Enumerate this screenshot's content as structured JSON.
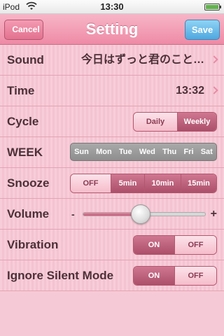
{
  "status": {
    "carrier": "iPod",
    "time": "13:30"
  },
  "nav": {
    "title": "Setting",
    "cancel_label": "Cancel",
    "save_label": "Save"
  },
  "rows": {
    "sound": {
      "label": "Sound",
      "value": "今日はずっと君のこと…"
    },
    "time": {
      "label": "Time",
      "value": "13:32"
    },
    "cycle": {
      "label": "Cycle",
      "options": [
        "Daily",
        "Weekly"
      ],
      "selected": "Weekly"
    },
    "week": {
      "label": "WEEK",
      "days": [
        "Sun",
        "Mon",
        "Tue",
        "Wed",
        "Thu",
        "Fri",
        "Sat"
      ]
    },
    "snooze": {
      "label": "Snooze",
      "options": [
        "OFF",
        "5min",
        "10min",
        "15min"
      ],
      "selected": "OFF"
    },
    "volume": {
      "label": "Volume",
      "minus": "-",
      "plus": "+",
      "level": 0.47
    },
    "vibration": {
      "label": "Vibration",
      "options": [
        "ON",
        "OFF"
      ],
      "selected": "ON"
    },
    "ignore_silent": {
      "label": "Ignore Silent Mode",
      "options": [
        "ON",
        "OFF"
      ],
      "selected": "ON"
    }
  },
  "colors": {
    "accent_pink": "#ee8aa5",
    "save_blue": "#4ea8e0",
    "text": "#4c3038"
  }
}
